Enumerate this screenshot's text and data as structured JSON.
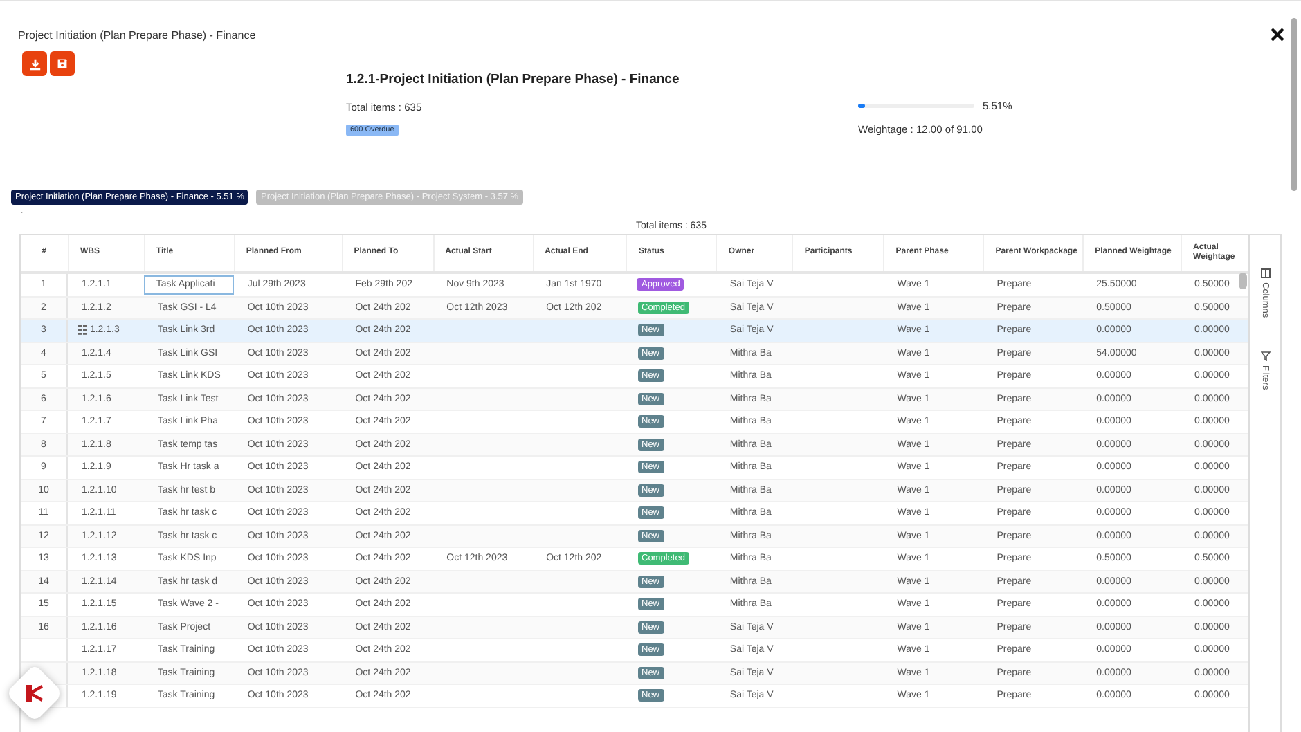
{
  "dialog": {
    "title": "Project Initiation (Plan Prepare Phase) - Finance"
  },
  "summary": {
    "heading": "1.2.1-Project Initiation (Plan Prepare Phase) - Finance",
    "total": "Total items : 635",
    "badge": "600 Overdue",
    "progress": {
      "level": 0.0551,
      "reading": "5.51%"
    },
    "weightage": "Weightage : 12.00 of 91.00"
  },
  "tabs": [
    {
      "label": "Project Initiation (Plan Prepare Phase) - Finance - 5.51 %",
      "selected": true
    },
    {
      "label": "Project Initiation (Plan Prepare Phase) - Project System - 3.57 %",
      "selected": false
    }
  ],
  "dot": ".",
  "table": {
    "total": "Total items : 635",
    "columns": [
      "#",
      "WBS",
      "Title",
      "Planned From",
      "Planned To",
      "Actual Start",
      "Actual End",
      "Status",
      "Owner",
      "Participants",
      "Parent Phase",
      "Parent Workpackage",
      "Planned Weightage",
      "Actual Weightage"
    ],
    "side_tabs": [
      "Columns",
      "Filters"
    ],
    "rows": [
      {
        "n": "1",
        "wbs": "1.2.1.1",
        "title": "Task Applicati",
        "from": "Jul 29th 2023",
        "to": "Feb 29th 202",
        "astart": "Nov 9th 2023",
        "aend": "Jan 1st 1970",
        "status": {
          "label": "Approved",
          "kind": "approved"
        },
        "owner": "Sai Teja V",
        "phase": "Wave 1",
        "wp": "Prepare",
        "pw": "25.50000",
        "aw": "0.50000",
        "selected": false,
        "focused": true
      },
      {
        "n": "2",
        "wbs": "1.2.1.2",
        "title": "Task GSI - L4",
        "from": "Oct 10th 2023",
        "to": "Oct 24th 202",
        "astart": "Oct 12th 2023",
        "aend": "Oct 12th 202",
        "status": {
          "label": "Completed",
          "kind": "completed"
        },
        "owner": "Sai Teja V",
        "phase": "Wave 1",
        "wp": "Prepare",
        "pw": "0.50000",
        "aw": "0.50000",
        "selected": false,
        "focused": false
      },
      {
        "n": "3",
        "wbs": "1.2.1.3",
        "title": "Task Link 3rd",
        "from": "Oct 10th 2023",
        "to": "Oct 24th 202",
        "status": {
          "label": "New",
          "kind": "new"
        },
        "owner": "Sai Teja V",
        "phase": "Wave 1",
        "wp": "Prepare",
        "pw": "0.00000",
        "aw": "0.00000",
        "selected": true,
        "focused": false
      },
      {
        "n": "4",
        "wbs": "1.2.1.4",
        "title": "Task Link GSI",
        "from": "Oct 10th 2023",
        "to": "Oct 24th 202",
        "status": {
          "label": "New",
          "kind": "new"
        },
        "owner": "Mithra Ba",
        "phase": "Wave 1",
        "wp": "Prepare",
        "pw": "54.00000",
        "aw": "0.00000",
        "selected": false,
        "focused": false
      },
      {
        "n": "5",
        "wbs": "1.2.1.5",
        "title": "Task Link KDS",
        "from": "Oct 10th 2023",
        "to": "Oct 24th 202",
        "status": {
          "label": "New",
          "kind": "new"
        },
        "owner": "Mithra Ba",
        "phase": "Wave 1",
        "wp": "Prepare",
        "pw": "0.00000",
        "aw": "0.00000",
        "selected": false,
        "focused": false
      },
      {
        "n": "6",
        "wbs": "1.2.1.6",
        "title": "Task Link Test",
        "from": "Oct 10th 2023",
        "to": "Oct 24th 202",
        "status": {
          "label": "New",
          "kind": "new"
        },
        "owner": "Mithra Ba",
        "phase": "Wave 1",
        "wp": "Prepare",
        "pw": "0.00000",
        "aw": "0.00000",
        "selected": false,
        "focused": false
      },
      {
        "n": "7",
        "wbs": "1.2.1.7",
        "title": "Task Link Pha",
        "from": "Oct 10th 2023",
        "to": "Oct 24th 202",
        "status": {
          "label": "New",
          "kind": "new"
        },
        "owner": "Mithra Ba",
        "phase": "Wave 1",
        "wp": "Prepare",
        "pw": "0.00000",
        "aw": "0.00000",
        "selected": false,
        "focused": false
      },
      {
        "n": "8",
        "wbs": "1.2.1.8",
        "title": "Task temp tas",
        "from": "Oct 10th 2023",
        "to": "Oct 24th 202",
        "status": {
          "label": "New",
          "kind": "new"
        },
        "owner": "Mithra Ba",
        "phase": "Wave 1",
        "wp": "Prepare",
        "pw": "0.00000",
        "aw": "0.00000",
        "selected": false,
        "focused": false
      },
      {
        "n": "9",
        "wbs": "1.2.1.9",
        "title": "Task Hr task a",
        "from": "Oct 10th 2023",
        "to": "Oct 24th 202",
        "status": {
          "label": "New",
          "kind": "new"
        },
        "owner": "Mithra Ba",
        "phase": "Wave 1",
        "wp": "Prepare",
        "pw": "0.00000",
        "aw": "0.00000",
        "selected": false,
        "focused": false
      },
      {
        "n": "10",
        "wbs": "1.2.1.10",
        "title": "Task hr test b",
        "from": "Oct 10th 2023",
        "to": "Oct 24th 202",
        "status": {
          "label": "New",
          "kind": "new"
        },
        "owner": "Mithra Ba",
        "phase": "Wave 1",
        "wp": "Prepare",
        "pw": "0.00000",
        "aw": "0.00000",
        "selected": false,
        "focused": false
      },
      {
        "n": "11",
        "wbs": "1.2.1.11",
        "title": "Task hr task c",
        "from": "Oct 10th 2023",
        "to": "Oct 24th 202",
        "status": {
          "label": "New",
          "kind": "new"
        },
        "owner": "Mithra Ba",
        "phase": "Wave 1",
        "wp": "Prepare",
        "pw": "0.00000",
        "aw": "0.00000",
        "selected": false,
        "focused": false
      },
      {
        "n": "12",
        "wbs": "1.2.1.12",
        "title": "Task hr task c",
        "from": "Oct 10th 2023",
        "to": "Oct 24th 202",
        "status": {
          "label": "New",
          "kind": "new"
        },
        "owner": "Mithra Ba",
        "phase": "Wave 1",
        "wp": "Prepare",
        "pw": "0.00000",
        "aw": "0.00000",
        "selected": false,
        "focused": false
      },
      {
        "n": "13",
        "wbs": "1.2.1.13",
        "title": "Task KDS Inp",
        "from": "Oct 10th 2023",
        "to": "Oct 24th 202",
        "astart": "Oct 12th 2023",
        "aend": "Oct 12th 202",
        "status": {
          "label": "Completed",
          "kind": "completed"
        },
        "owner": "Mithra Ba",
        "phase": "Wave 1",
        "wp": "Prepare",
        "pw": "0.50000",
        "aw": "0.50000",
        "selected": false,
        "focused": false
      },
      {
        "n": "14",
        "wbs": "1.2.1.14",
        "title": "Task hr task d",
        "from": "Oct 10th 2023",
        "to": "Oct 24th 202",
        "status": {
          "label": "New",
          "kind": "new"
        },
        "owner": "Mithra Ba",
        "phase": "Wave 1",
        "wp": "Prepare",
        "pw": "0.00000",
        "aw": "0.00000",
        "selected": false,
        "focused": false
      },
      {
        "n": "15",
        "wbs": "1.2.1.15",
        "title": "Task Wave 2 -",
        "from": "Oct 10th 2023",
        "to": "Oct 24th 202",
        "status": {
          "label": "New",
          "kind": "new"
        },
        "owner": "Mithra Ba",
        "phase": "Wave 1",
        "wp": "Prepare",
        "pw": "0.00000",
        "aw": "0.00000",
        "selected": false,
        "focused": false
      },
      {
        "n": "16",
        "wbs": "1.2.1.16",
        "title": "Task Project",
        "from": "Oct 10th 2023",
        "to": "Oct 24th 202",
        "status": {
          "label": "New",
          "kind": "new"
        },
        "owner": "Sai Teja V",
        "phase": "Wave 1",
        "wp": "Prepare",
        "pw": "0.00000",
        "aw": "0.00000",
        "selected": false,
        "focused": false
      },
      {
        "wbs": "1.2.1.17",
        "title": "Task Training",
        "from": "Oct 10th 2023",
        "to": "Oct 24th 202",
        "status": {
          "label": "New",
          "kind": "new"
        },
        "owner": "Sai Teja V",
        "phase": "Wave 1",
        "wp": "Prepare",
        "pw": "0.00000",
        "aw": "0.00000",
        "selected": false,
        "focused": false
      },
      {
        "wbs": "1.2.1.18",
        "title": "Task Training",
        "from": "Oct 10th 2023",
        "to": "Oct 24th 202",
        "status": {
          "label": "New",
          "kind": "new"
        },
        "owner": "Sai Teja V",
        "phase": "Wave 1",
        "wp": "Prepare",
        "pw": "0.00000",
        "aw": "0.00000",
        "selected": false,
        "focused": false
      },
      {
        "wbs": "1.2.1.19",
        "title": "Task Training",
        "from": "Oct 10th 2023",
        "to": "Oct 24th 202",
        "status": {
          "label": "New",
          "kind": "new"
        },
        "owner": "Sai Teja V",
        "phase": "Wave 1",
        "wp": "Prepare",
        "pw": "0.00000",
        "aw": "0.00000",
        "selected": false,
        "focused": false
      }
    ]
  }
}
